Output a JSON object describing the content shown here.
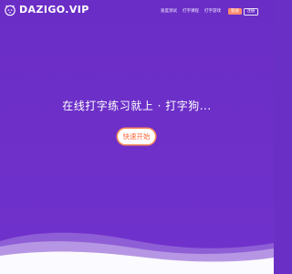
{
  "brand": {
    "name": "DAZIGO.VIP",
    "icon": "dog-mascot-icon"
  },
  "nav": {
    "links": [
      "速度测试",
      "打字课程",
      "打字游戏"
    ],
    "login_label": "登录",
    "register_label": "注册"
  },
  "hero": {
    "headline": "在线打字练习就上 · 打字狗...",
    "cta_label": "快速开始"
  },
  "colors": {
    "background": "#6d2fc8",
    "accent": "#ff8a6d",
    "cta_text": "#ff6a3d",
    "wave": "#ffffff"
  }
}
